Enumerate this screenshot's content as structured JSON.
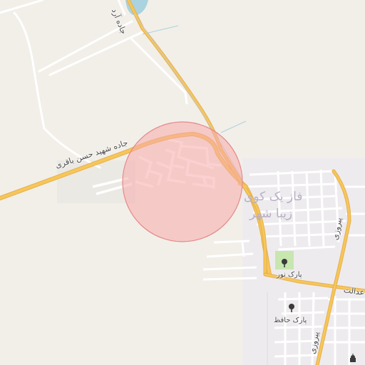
{
  "map": {
    "highlight": {
      "fill": "#f7a9a9",
      "stroke": "#e58a8a"
    },
    "colors": {
      "background": "#f2efe9",
      "major_road": "#f6c65b",
      "minor_road": "#ffffff",
      "water": "#aad3df",
      "park": "#c8e6b0",
      "residential": "#ebe7f2"
    },
    "labels": {
      "road_shahid": "جاده شهید حسن باقری",
      "road_north": "جاده آرد",
      "road_east": "پیروزی",
      "road_east2": "پیروزی",
      "road_south": "عدالت",
      "district_line1": "فاز یک کوی",
      "district_line2": "زیبا شهر",
      "park_noor": "پارک نور",
      "park_hafez": "پارک حافظ"
    },
    "icons": [
      "tree-icon",
      "tree-icon",
      "mosque-icon"
    ]
  }
}
